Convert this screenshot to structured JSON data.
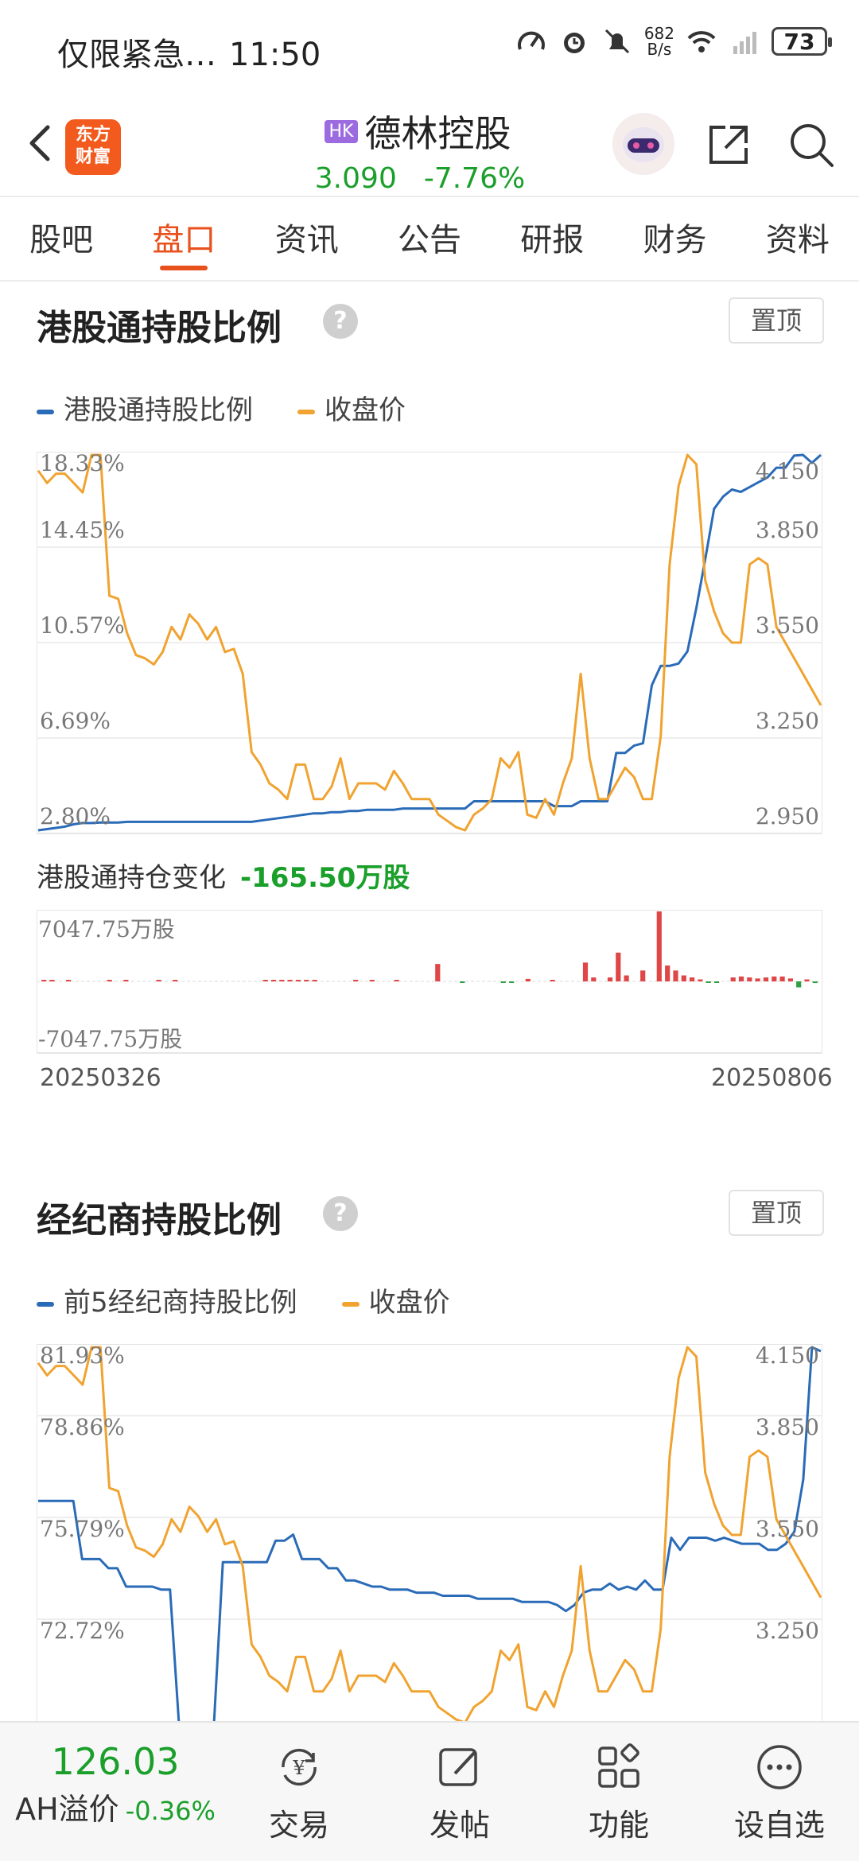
{
  "status_bar": {
    "notification": "仅限紧急…",
    "time": "11:50",
    "net_speed_value": "682",
    "net_speed_unit": "B/s",
    "battery": "73"
  },
  "header": {
    "logo_text_line1": "东方",
    "logo_text_line2": "财富",
    "market_badge": "HK",
    "stock_name": "德林控股",
    "price": "3.090",
    "change_pct": "-7.76%",
    "change_color": "#1a9f2a"
  },
  "tabs": [
    {
      "label": "股吧"
    },
    {
      "label": "盘口"
    },
    {
      "label": "资讯"
    },
    {
      "label": "公告"
    },
    {
      "label": "研报"
    },
    {
      "label": "财务"
    },
    {
      "label": "资料"
    }
  ],
  "active_tab": "盘口",
  "section1": {
    "title": "港股通持股比例",
    "pin_label": "置顶",
    "legend": [
      {
        "label": "港股通持股比例",
        "color": "#2a6bb8"
      },
      {
        "label": "收盘价",
        "color": "#f0a330"
      }
    ],
    "left_ticks": [
      "18.33%",
      "14.45%",
      "10.57%",
      "6.69%",
      "2.80%"
    ],
    "right_ticks": [
      "4.150",
      "3.850",
      "3.550",
      "3.250",
      "2.950"
    ],
    "holding_change_label": "港股通持仓变化",
    "holding_change_value": "-165.50万股",
    "bar_top_label": "7047.75万股",
    "bar_bottom_label": "-7047.75万股",
    "date_start": "20250326",
    "date_end": "20250806"
  },
  "section2": {
    "title": "经纪商持股比例",
    "pin_label": "置顶",
    "legend": [
      {
        "label": "前5经纪商持股比例",
        "color": "#2a6bb8"
      },
      {
        "label": "收盘价",
        "color": "#f0a330"
      }
    ],
    "left_ticks": [
      "81.93%",
      "78.86%",
      "75.79%",
      "72.72%"
    ],
    "right_ticks": [
      "4.150",
      "3.850",
      "3.550",
      "3.250"
    ]
  },
  "chart_data": [
    {
      "type": "line",
      "ylim_left": [
        2.8,
        18.33
      ],
      "ylim_right": [
        2.95,
        4.15
      ],
      "series": [
        {
          "name": "港股通持股比例",
          "axis": "left",
          "color": "#2a6bb8",
          "values": [
            2.8,
            2.85,
            2.9,
            2.95,
            3.05,
            3.1,
            3.1,
            3.12,
            3.12,
            3.12,
            3.15,
            3.15,
            3.15,
            3.15,
            3.15,
            3.15,
            3.15,
            3.15,
            3.15,
            3.15,
            3.15,
            3.15,
            3.15,
            3.15,
            3.15,
            3.2,
            3.25,
            3.3,
            3.35,
            3.4,
            3.45,
            3.5,
            3.5,
            3.55,
            3.55,
            3.6,
            3.6,
            3.65,
            3.65,
            3.65,
            3.65,
            3.7,
            3.7,
            3.7,
            3.7,
            3.7,
            3.7,
            3.7,
            3.7,
            4.0,
            4.0,
            4.0,
            4.0,
            4.0,
            4.0,
            4.0,
            4.0,
            4.0,
            3.8,
            3.8,
            3.8,
            4.0,
            4.0,
            4.0,
            4.0,
            6.0,
            6.0,
            6.3,
            6.4,
            8.8,
            9.6,
            9.6,
            9.7,
            10.2,
            12.0,
            14.0,
            16.1,
            16.6,
            16.9,
            16.8,
            17.0,
            17.2,
            17.4,
            17.8,
            17.8,
            18.3,
            18.33,
            18.0,
            18.33
          ]
        },
        {
          "name": "收盘价",
          "axis": "right",
          "color": "#f0a330",
          "values": [
            4.1,
            4.06,
            4.09,
            4.09,
            4.06,
            4.03,
            4.15,
            4.15,
            3.7,
            3.69,
            3.58,
            3.51,
            3.5,
            3.48,
            3.52,
            3.6,
            3.56,
            3.64,
            3.61,
            3.56,
            3.6,
            3.52,
            3.53,
            3.45,
            3.2,
            3.16,
            3.1,
            3.08,
            3.05,
            3.16,
            3.16,
            3.05,
            3.05,
            3.09,
            3.18,
            3.05,
            3.1,
            3.1,
            3.1,
            3.08,
            3.14,
            3.1,
            3.05,
            3.05,
            3.05,
            3.0,
            2.98,
            2.96,
            2.95,
            3.0,
            3.02,
            3.05,
            3.18,
            3.15,
            3.2,
            3.0,
            2.99,
            3.05,
            3.0,
            3.1,
            3.18,
            3.45,
            3.18,
            3.05,
            3.05,
            3.1,
            3.15,
            3.12,
            3.05,
            3.05,
            3.25,
            3.8,
            4.05,
            4.15,
            4.12,
            3.75,
            3.65,
            3.58,
            3.55,
            3.55,
            3.8,
            3.82,
            3.8,
            3.6,
            3.55,
            3.5,
            3.45,
            3.4,
            3.35
          ]
        }
      ]
    },
    {
      "type": "bar",
      "title": "港股通持仓变化",
      "ylim": [
        -7047.75,
        7047.75
      ],
      "unit": "万股",
      "values": [
        150,
        60,
        0,
        80,
        0,
        0,
        0,
        0,
        90,
        0,
        60,
        0,
        0,
        0,
        40,
        0,
        40,
        0,
        0,
        0,
        0,
        0,
        0,
        0,
        0,
        0,
        0,
        20,
        20,
        20,
        20,
        20,
        20,
        20,
        0,
        0,
        0,
        0,
        20,
        0,
        20,
        0,
        0,
        20,
        0,
        0,
        0,
        0,
        1750,
        0,
        0,
        -60,
        0,
        0,
        0,
        0,
        -120,
        -80,
        0,
        250,
        0,
        0,
        150,
        0,
        0,
        0,
        1900,
        400,
        0,
        400,
        2900,
        600,
        0,
        1100,
        0,
        7047.75,
        1600,
        1100,
        600,
        400,
        200,
        -100,
        -150,
        0,
        400,
        500,
        400,
        300,
        400,
        500,
        500,
        300,
        -600,
        200,
        -165.5
      ]
    },
    {
      "type": "line",
      "ylim_left": [
        69.65,
        81.93
      ],
      "ylim_right": [
        2.95,
        4.15
      ],
      "series": [
        {
          "name": "前5经纪商持股比例",
          "axis": "left",
          "color": "#2a6bb8",
          "values": [
            76.9,
            76.9,
            76.9,
            76.9,
            76.9,
            75.0,
            75.0,
            75.0,
            74.7,
            74.7,
            74.1,
            74.1,
            74.1,
            74.1,
            74.0,
            74.0,
            69.65,
            69.65,
            69.65,
            69.65,
            69.65,
            74.9,
            74.9,
            74.9,
            74.9,
            74.9,
            74.9,
            75.6,
            75.6,
            75.8,
            75.0,
            75.0,
            75.0,
            74.7,
            74.7,
            74.3,
            74.3,
            74.2,
            74.1,
            74.1,
            74.0,
            74.0,
            74.0,
            73.9,
            73.9,
            73.9,
            73.8,
            73.8,
            73.8,
            73.8,
            73.7,
            73.7,
            73.7,
            73.7,
            73.7,
            73.6,
            73.6,
            73.6,
            73.6,
            73.5,
            73.3,
            73.5,
            73.9,
            74.0,
            74.0,
            74.2,
            74.0,
            74.1,
            74.0,
            74.3,
            74.0,
            74.0,
            75.7,
            75.3,
            75.7,
            75.7,
            75.7,
            75.6,
            75.7,
            75.6,
            75.5,
            75.5,
            75.5,
            75.3,
            75.3,
            75.5,
            75.9,
            77.6,
            81.93,
            81.8
          ]
        },
        {
          "name": "收盘价",
          "axis": "right",
          "color": "#f0a330",
          "values": [
            4.1,
            4.06,
            4.09,
            4.09,
            4.06,
            4.03,
            4.15,
            4.15,
            3.7,
            3.69,
            3.58,
            3.51,
            3.5,
            3.48,
            3.52,
            3.6,
            3.56,
            3.64,
            3.61,
            3.56,
            3.6,
            3.52,
            3.53,
            3.45,
            3.2,
            3.16,
            3.1,
            3.08,
            3.05,
            3.16,
            3.16,
            3.05,
            3.05,
            3.09,
            3.18,
            3.05,
            3.1,
            3.1,
            3.1,
            3.08,
            3.14,
            3.1,
            3.05,
            3.05,
            3.05,
            3.0,
            2.98,
            2.96,
            2.95,
            3.0,
            3.02,
            3.05,
            3.18,
            3.15,
            3.2,
            3.0,
            2.99,
            3.05,
            3.0,
            3.1,
            3.18,
            3.45,
            3.18,
            3.05,
            3.05,
            3.1,
            3.15,
            3.12,
            3.05,
            3.05,
            3.25,
            3.8,
            4.05,
            4.15,
            4.12,
            3.75,
            3.65,
            3.58,
            3.55,
            3.55,
            3.8,
            3.82,
            3.8,
            3.6,
            3.55,
            3.5,
            3.45,
            3.4,
            3.35
          ]
        }
      ]
    }
  ],
  "bottom_bar": {
    "ah_value": "126.03",
    "ah_label": "AH溢价",
    "ah_pct": "-0.36%",
    "items": [
      {
        "label": "交易",
        "icon": "trade-icon"
      },
      {
        "label": "发帖",
        "icon": "post-icon"
      },
      {
        "label": "功能",
        "icon": "function-grid-icon"
      },
      {
        "label": "设自选",
        "icon": "more-dots-icon"
      }
    ]
  }
}
